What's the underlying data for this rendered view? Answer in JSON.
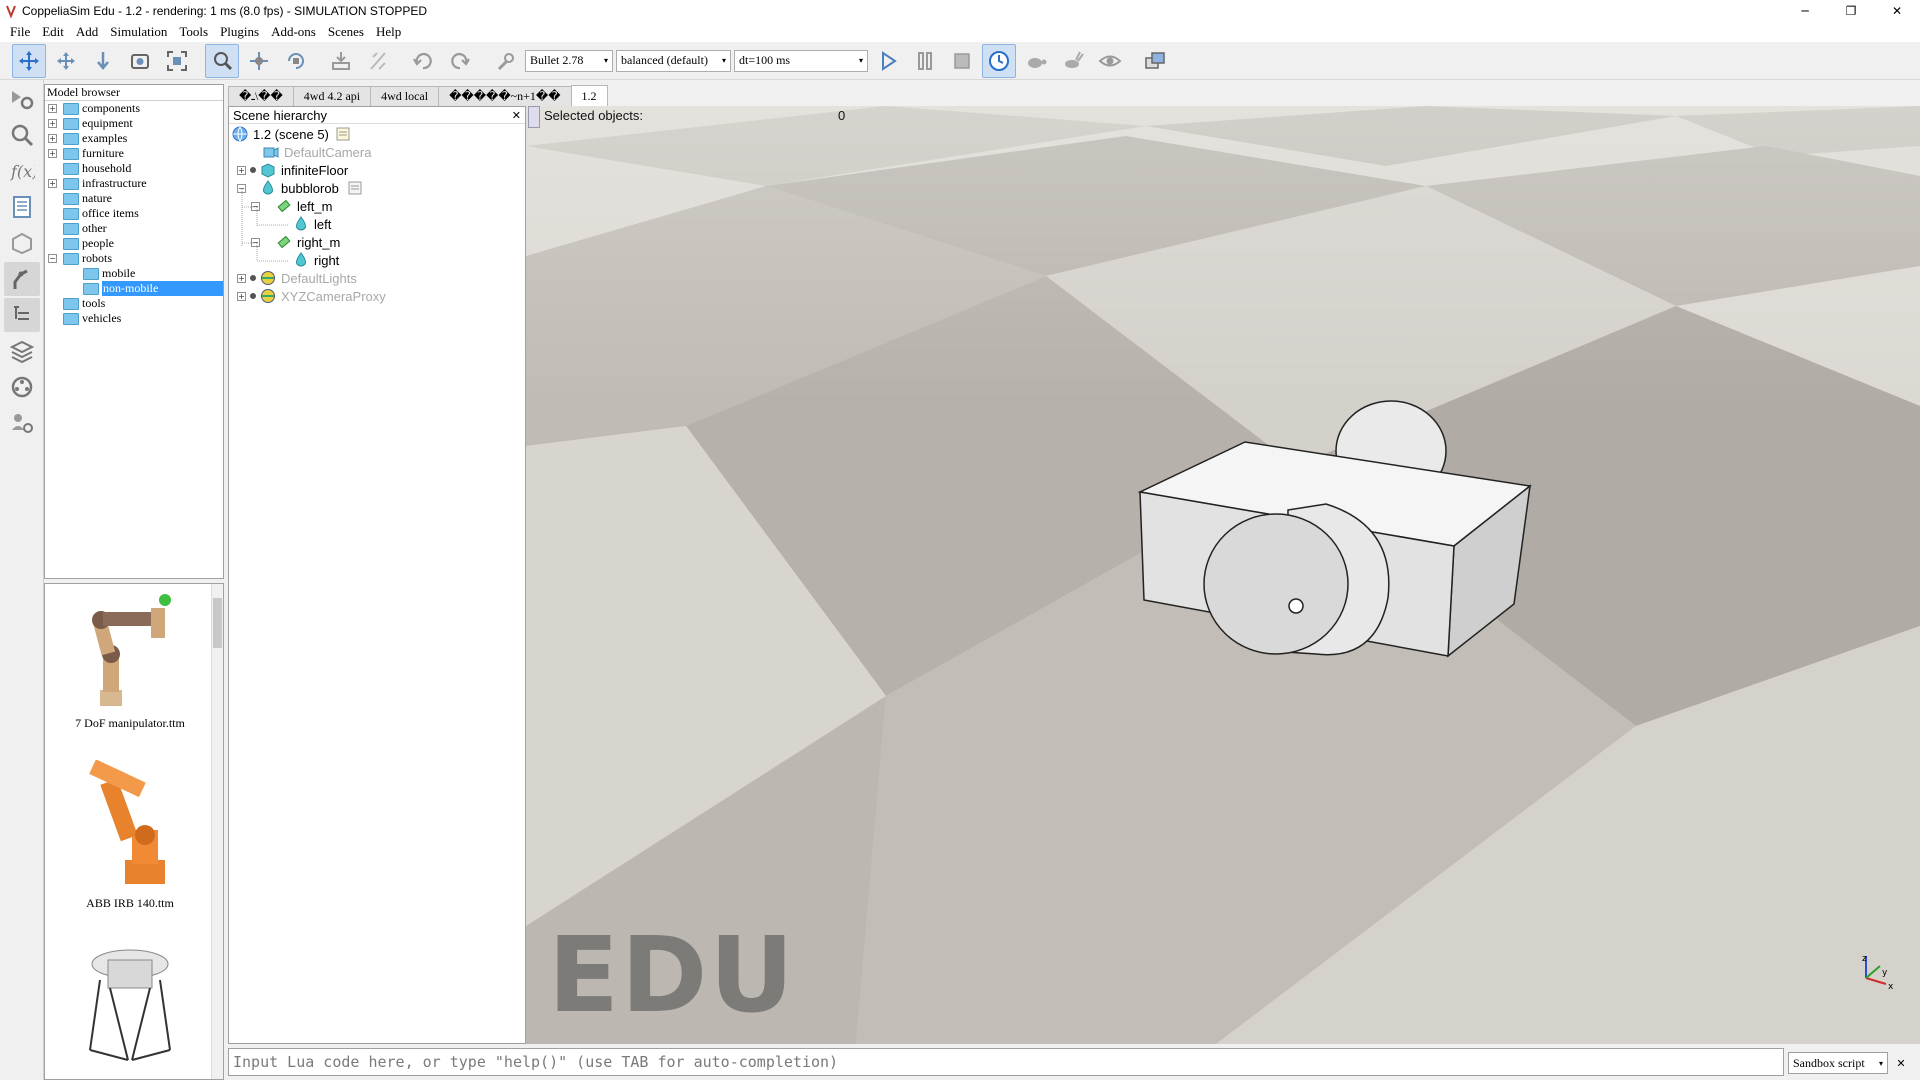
{
  "window": {
    "title": "CoppeliaSim Edu - 1.2 - rendering: 1 ms (8.0 fps) - SIMULATION STOPPED",
    "controls": {
      "minimize": "─",
      "restore": "❐",
      "close": "✕"
    }
  },
  "menu": [
    "File",
    "Edit",
    "Add",
    "Simulation",
    "Tools",
    "Plugins",
    "Add-ons",
    "Scenes",
    "Help"
  ],
  "toolbar": {
    "engine": "Bullet 2.78",
    "accuracy": "balanced (default)",
    "timestep": "dt=100 ms",
    "dropdown_arrow": "▾"
  },
  "model_browser": {
    "header": "Model browser",
    "items": [
      {
        "label": "components",
        "expandable": true
      },
      {
        "label": "equipment",
        "expandable": true
      },
      {
        "label": "examples",
        "expandable": true
      },
      {
        "label": "furniture",
        "expandable": true
      },
      {
        "label": "household",
        "expandable": false
      },
      {
        "label": "infrastructure",
        "expandable": true
      },
      {
        "label": "nature",
        "expandable": false
      },
      {
        "label": "office items",
        "expandable": false
      },
      {
        "label": "other",
        "expandable": false
      },
      {
        "label": "people",
        "expandable": false
      },
      {
        "label": "robots",
        "expandable": true,
        "expanded": true
      },
      {
        "label": "mobile",
        "child": true
      },
      {
        "label": "non-mobile",
        "child": true,
        "selected": true
      },
      {
        "label": "tools",
        "expandable": false
      },
      {
        "label": "vehicles",
        "expandable": false
      }
    ],
    "expand_plus": "+",
    "expand_minus": "−"
  },
  "thumbnails": [
    {
      "caption": "7 DoF manipulator.ttm"
    },
    {
      "caption": "ABB IRB 140.ttm"
    },
    {
      "caption": ""
    }
  ],
  "scene_tabs": [
    "�ـ\\��",
    "4wd 4.2 api",
    "4wd local",
    "�����~n+1��",
    "1.2"
  ],
  "hierarchy": {
    "header": "Scene hierarchy",
    "close": "✕",
    "items": [
      {
        "label": "1.2 (scene 5)",
        "dim": false
      },
      {
        "label": "DefaultCamera",
        "dim": true
      },
      {
        "label": "infiniteFloor",
        "dim": false
      },
      {
        "label": "bubblorob",
        "dim": false
      },
      {
        "label": "left_m",
        "dim": false
      },
      {
        "label": "left",
        "dim": false
      },
      {
        "label": "right_m",
        "dim": false
      },
      {
        "label": "right",
        "dim": false
      },
      {
        "label": "DefaultLights",
        "dim": true
      },
      {
        "label": "XYZCameraProxy",
        "dim": true
      }
    ]
  },
  "viewport": {
    "selected_label": "Selected objects:",
    "selected_count": "0",
    "watermark": "EDU",
    "axis_x": "x",
    "axis_y": "y",
    "axis_z": "z"
  },
  "command_line": {
    "placeholder": "Input Lua code here, or type \"help()\" (use TAB for auto-completion)",
    "script": "Sandbox script",
    "close": "✕"
  },
  "colors": {
    "selection": "#3399ff",
    "folder": "#7ec6ec",
    "accent_blue": "#2a6fc9"
  }
}
